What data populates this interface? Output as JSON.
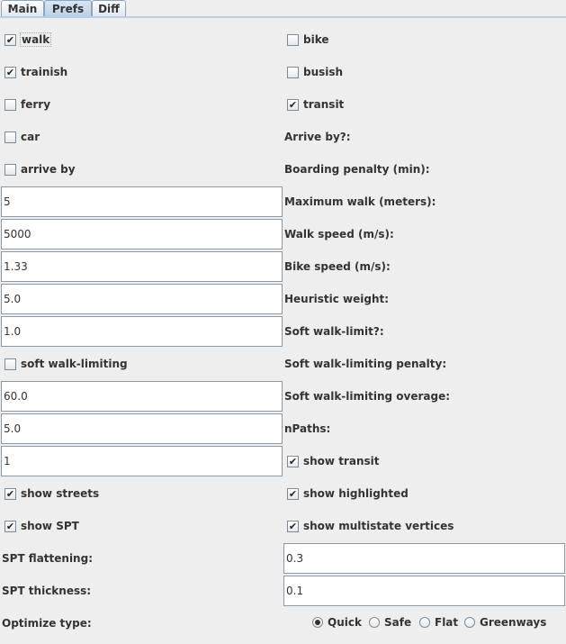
{
  "tabs": {
    "main": "Main",
    "prefs": "Prefs",
    "diff": "Diff"
  },
  "prefs": {
    "walk": {
      "label": "walk",
      "checked": true
    },
    "bike": {
      "label": "bike",
      "checked": false
    },
    "trainish": {
      "label": "trainish",
      "checked": true
    },
    "busish": {
      "label": "busish",
      "checked": false
    },
    "ferry": {
      "label": "ferry",
      "checked": false
    },
    "transit": {
      "label": "transit",
      "checked": true
    },
    "car": {
      "label": "car",
      "checked": false
    },
    "arrive_by_q": "Arrive by?:",
    "arrive_by": {
      "label": "arrive by",
      "checked": false
    },
    "boarding_penalty_label": "Boarding penalty (min):",
    "boarding_penalty_value": "5",
    "max_walk_label": "Maximum walk (meters):",
    "max_walk_value": "5000",
    "walk_speed_label": "Walk speed (m/s):",
    "walk_speed_value": "1.33",
    "bike_speed_label": "Bike speed (m/s):",
    "bike_speed_value": "5.0",
    "heuristic_weight_label": "Heuristic weight:",
    "heuristic_weight_value": "1.0",
    "soft_walk_limit_q": "Soft walk-limit?:",
    "soft_walk_limiting": {
      "label": "soft walk-limiting",
      "checked": false
    },
    "soft_walk_penalty_label": "Soft walk-limiting penalty:",
    "soft_walk_penalty_value": "60.0",
    "soft_walk_overage_label": "Soft walk-limiting overage:",
    "soft_walk_overage_value": "5.0",
    "npaths_label": "nPaths:",
    "npaths_value": "1",
    "show_transit": {
      "label": "show transit",
      "checked": true
    },
    "show_streets": {
      "label": "show streets",
      "checked": true
    },
    "show_highlighted": {
      "label": "show highlighted",
      "checked": true
    },
    "show_spt": {
      "label": "show SPT",
      "checked": true
    },
    "show_multistate": {
      "label": "show multistate vertices",
      "checked": true
    },
    "spt_flattening_label": "SPT flattening:",
    "spt_flattening_value": "0.3",
    "spt_thickness_label": "SPT thickness:",
    "spt_thickness_value": "0.1",
    "optimize_type_label": "Optimize type:",
    "optimize_options": [
      "Quick",
      "Safe",
      "Flat",
      "Greenways"
    ],
    "optimize_selected": "Quick"
  }
}
